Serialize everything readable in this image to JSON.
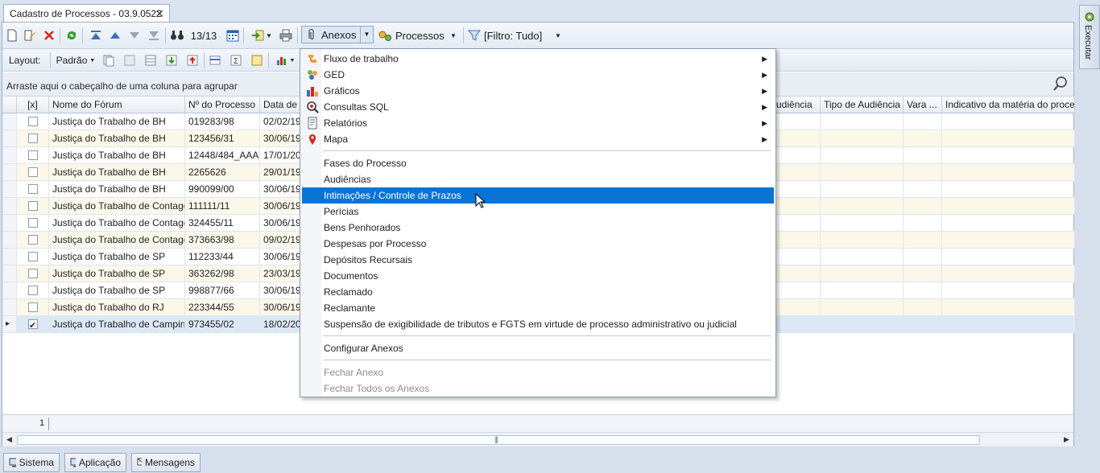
{
  "tab": {
    "title": "Cadastro de Processos - 03.9.0522",
    "close": "✕"
  },
  "toolbar": {
    "record_counter": "13/13",
    "anexos_label": "Anexos",
    "processos_label": "Processos",
    "filtro_label": "[Filtro: Tudo]",
    "layout_label": "Layout:",
    "padrao_label": "Padrão"
  },
  "group_hint": "Arraste aqui o cabeçalho de uma coluna para agrupar",
  "grid": {
    "headers": [
      "[x]",
      "Nome do Fórum",
      "Nº do Processo",
      "Data de A",
      "udiência",
      "Tipo de Audiência",
      "Vara ...",
      "Indicativo da matéria do processo"
    ],
    "rows": [
      {
        "forum": "Justiça do Trabalho de BH",
        "processo": "019283/98",
        "data": "02/02/19",
        "checked": false
      },
      {
        "forum": "Justiça do Trabalho de BH",
        "processo": "123456/31",
        "data": "30/06/19",
        "checked": false
      },
      {
        "forum": "Justiça do Trabalho de BH",
        "processo": "12448/484_AAA",
        "data": "17/01/20",
        "checked": false
      },
      {
        "forum": "Justiça do Trabalho de BH",
        "processo": "2265626",
        "data": "29/01/19",
        "checked": false
      },
      {
        "forum": "Justiça do Trabalho de BH",
        "processo": "990099/00",
        "data": "30/06/19",
        "checked": false
      },
      {
        "forum": "Justiça do Trabalho de Contagem",
        "processo": "111111/11",
        "data": "30/06/19",
        "checked": false
      },
      {
        "forum": "Justiça do Trabalho de Contagem",
        "processo": "324455/11",
        "data": "30/06/19",
        "checked": false
      },
      {
        "forum": "Justiça do Trabalho de Contagem",
        "processo": "373663/98",
        "data": "09/02/19",
        "checked": false
      },
      {
        "forum": "Justiça do Trabalho de SP",
        "processo": "112233/44",
        "data": "30/06/19",
        "checked": false
      },
      {
        "forum": "Justiça do Trabalho de SP",
        "processo": "363262/98",
        "data": "23/03/19",
        "checked": false
      },
      {
        "forum": "Justiça do Trabalho de SP",
        "processo": "998877/66",
        "data": "30/06/19",
        "checked": false
      },
      {
        "forum": "Justiça do Trabalho do RJ",
        "processo": "223344/55",
        "data": "30/06/19",
        "checked": false
      },
      {
        "forum": "Justiça do Trabalho de Campinas",
        "processo": "973455/02",
        "data": "18/02/20",
        "checked": true
      }
    ],
    "footer_count": "1"
  },
  "menu": {
    "submenus": [
      {
        "label": "Fluxo de trabalho",
        "icon": "workflow-icon"
      },
      {
        "label": "GED",
        "icon": "ged-icon"
      },
      {
        "label": "Gráficos",
        "icon": "chart-icon"
      },
      {
        "label": "Consultas SQL",
        "icon": "sql-query-icon"
      },
      {
        "label": "Relatórios",
        "icon": "report-icon"
      },
      {
        "label": "Mapa",
        "icon": "map-pin-icon"
      }
    ],
    "items": [
      "Fases do Processo",
      "Audiências",
      "Intimações / Controle de Prazos",
      "Perícias",
      "Bens Penhorados",
      "Despesas por Processo",
      "Depósitos Recursais",
      "Documentos",
      "Reclamado",
      "Reclamante",
      "Suspensão de exigibilidade de tributos e FGTS em virtude de processo administrativo ou judicial"
    ],
    "highlighted": "Intimações / Controle de Prazos",
    "configure": "Configurar Anexos",
    "disabled": [
      "Fechar Anexo",
      "Fechar Todos os Anexos"
    ]
  },
  "sidebar": {
    "executar": "Executar"
  },
  "taskbar": {
    "sistema": "Sistema",
    "aplicacao": "Aplicação",
    "mensagens": "Mensagens"
  },
  "colors": {
    "highlight": "#0a74d6",
    "row_alt": "#fbf8ea",
    "frame_bg": "#d6dfec"
  }
}
